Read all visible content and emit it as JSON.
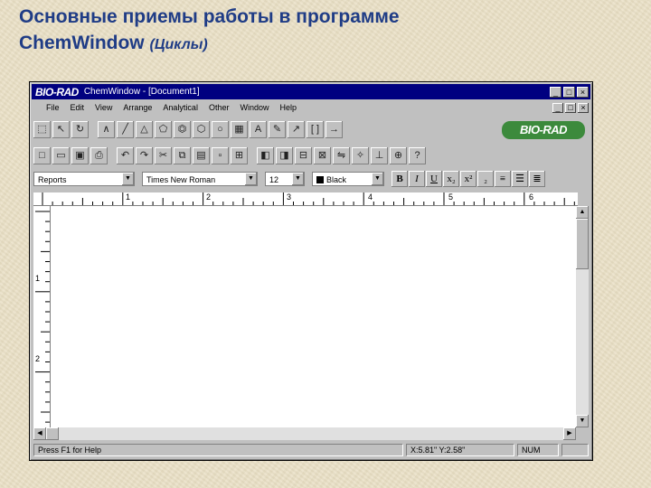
{
  "slide": {
    "title_line1": "Основные приемы работы в программе",
    "title_line2": "ChemWindow",
    "title_paren": "(Циклы)"
  },
  "window": {
    "logo": "BIO-RAD",
    "title": "ChemWindow - [Document1]",
    "buttons": [
      "_",
      "□",
      "×"
    ]
  },
  "menu": [
    "File",
    "Edit",
    "View",
    "Arrange",
    "Analytical",
    "Other",
    "Window",
    "Help"
  ],
  "brand_logo": "BIO-RAD",
  "format": {
    "style": "Reports",
    "font": "Times New Roman",
    "size": "12",
    "color": "Black",
    "color_hex": "#000000"
  },
  "ruler": {
    "h_marks": [
      "1",
      "2",
      "3",
      "4",
      "5",
      "6"
    ],
    "v_marks": [
      "1",
      "2"
    ]
  },
  "status": {
    "help": "Press F1 for Help",
    "coords": "X:5.81\" Y:2.58\"",
    "num": "NUM"
  },
  "colors": {
    "titlebar": "#000080",
    "slide_title": "#1f3c86",
    "brand": "#3c8a3c"
  }
}
